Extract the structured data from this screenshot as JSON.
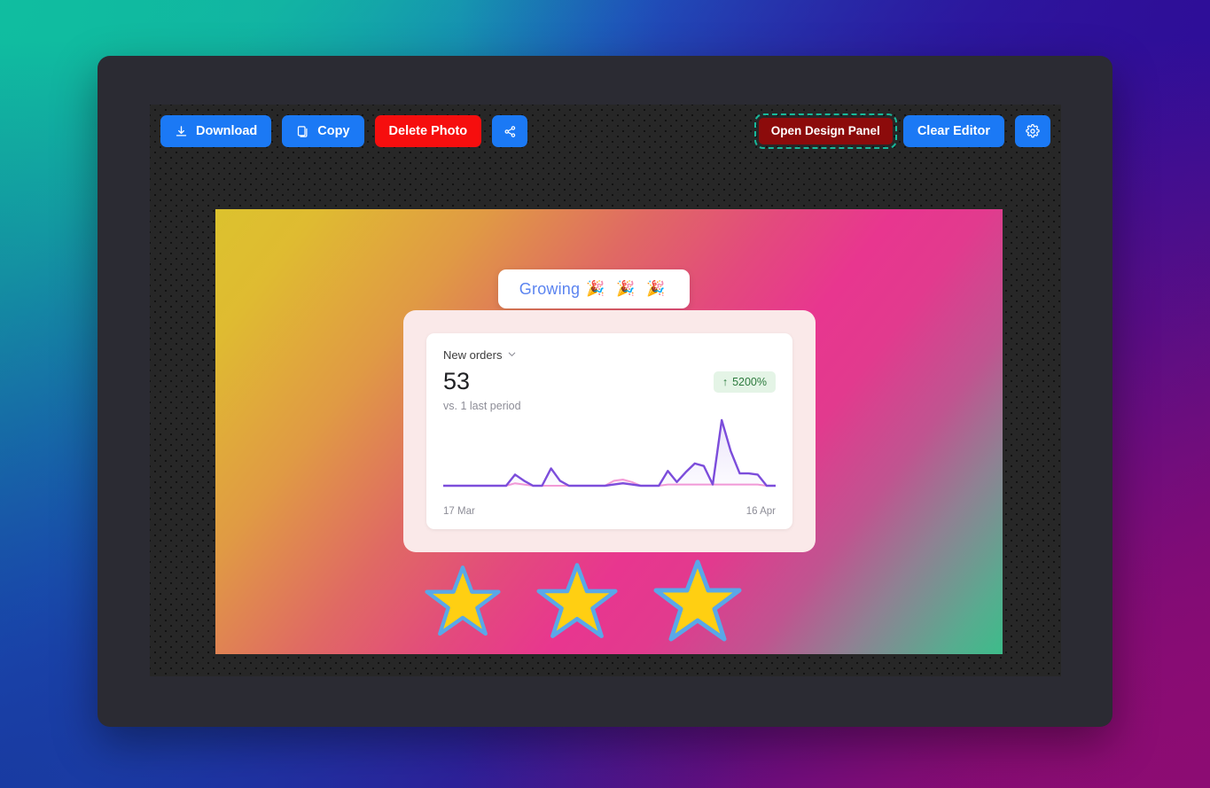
{
  "toolbar": {
    "left_buttons": [
      {
        "label": "Download",
        "icon": "download-icon",
        "style": "blue"
      },
      {
        "label": "Copy",
        "icon": "copy-icon",
        "style": "blue"
      },
      {
        "label": "Delete Photo",
        "icon": null,
        "style": "red"
      },
      {
        "label": "",
        "icon": "share-icon",
        "style": "blue-icon"
      }
    ],
    "right_buttons": [
      {
        "label": "Open Design Panel",
        "icon": null,
        "style": "dark-red-focused"
      },
      {
        "label": "Clear Editor",
        "icon": null,
        "style": "blue"
      },
      {
        "label": "",
        "icon": "gear-icon",
        "style": "blue-icon"
      }
    ]
  },
  "photo": {
    "banner": {
      "text": "Growing",
      "emoji": "🎉 🎉 🎉"
    },
    "metric": {
      "title": "New orders",
      "value": "53",
      "delta": "5200%",
      "delta_arrow": "↑",
      "comparison": "vs. 1 last period",
      "axis_start": "17 Mar",
      "axis_end": "16 Apr"
    },
    "stars": [
      "star-1",
      "star-2",
      "star-3"
    ]
  },
  "colors": {
    "accent_blue": "#1b79f5",
    "danger_red": "#f60e0e",
    "dark_red": "#8c0b0b",
    "focus_outline": "#18b89a",
    "badge_bg": "#e4f4e6",
    "badge_text": "#2c7a3d",
    "line_primary": "#7c4ddb",
    "line_secondary": "#f49ad6",
    "star_fill": "#ffcf12",
    "star_stroke": "#59a8e8",
    "growing_text": "#5b84f0"
  },
  "chart_data": {
    "type": "line",
    "title": "New orders",
    "xlabel": "",
    "ylabel": "",
    "x_tick_labels": [
      "17 Mar",
      "16 Apr"
    ],
    "grid": false,
    "legend": "none",
    "ylim": [
      0,
      53
    ],
    "series": [
      {
        "name": "New orders (current period)",
        "color": "#7c4ddb",
        "values": [
          0,
          0,
          0,
          0,
          0,
          0,
          0,
          0,
          9,
          4,
          0,
          0,
          14,
          4,
          0,
          0,
          0,
          0,
          0,
          1,
          2,
          1,
          0,
          0,
          0,
          12,
          3,
          11,
          18,
          16,
          1,
          53,
          28,
          10,
          10,
          9,
          0,
          0
        ]
      },
      {
        "name": "Previous period",
        "color": "#f49ad6",
        "values": [
          0,
          0,
          0,
          0,
          0,
          0,
          0,
          0,
          2,
          1,
          0,
          0,
          0,
          0,
          0,
          0,
          0,
          0,
          0,
          4,
          5,
          3,
          0,
          0,
          0,
          1,
          1,
          1,
          1,
          1,
          1,
          1,
          1,
          1,
          1,
          1,
          0,
          0
        ]
      }
    ]
  }
}
